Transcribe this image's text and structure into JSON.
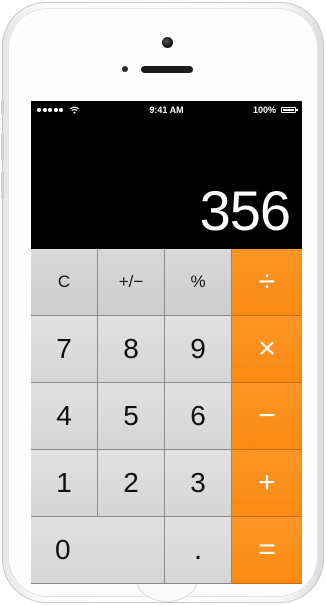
{
  "status_bar": {
    "time": "9:41 AM",
    "battery": "100%"
  },
  "display": {
    "value": "356"
  },
  "keys": {
    "clear": "C",
    "sign": "+/−",
    "percent": "%",
    "divide": "÷",
    "seven": "7",
    "eight": "8",
    "nine": "9",
    "multiply": "×",
    "four": "4",
    "five": "5",
    "six": "6",
    "minus": "−",
    "one": "1",
    "two": "2",
    "three": "3",
    "plus": "+",
    "zero": "0",
    "decimal": ".",
    "equals": "="
  },
  "colors": {
    "operator_key": "#f98a12",
    "function_key": "#d2d2d2",
    "number_key": "#dcdcdc",
    "screen_bg": "#000000"
  },
  "icons": [
    "signal-icon",
    "wifi-icon",
    "battery-icon"
  ]
}
